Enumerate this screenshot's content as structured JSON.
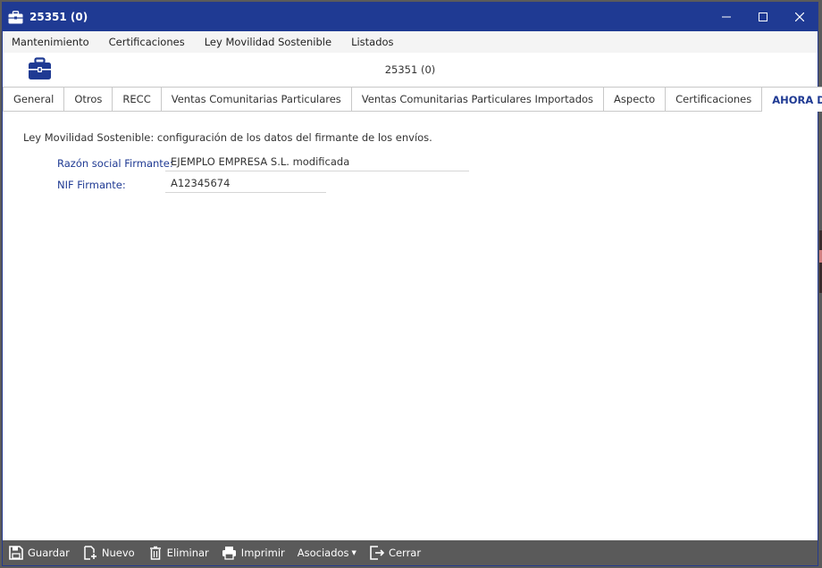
{
  "window": {
    "title": "25351 (0)",
    "minimize": "—",
    "maximize": "☐",
    "close": "✕"
  },
  "menu": [
    "Mantenimiento",
    "Certificaciones",
    "Ley Movilidad Sostenible",
    "Listados"
  ],
  "header": {
    "record_title": "25351 (0)"
  },
  "tabs": [
    {
      "label": "General",
      "active": false
    },
    {
      "label": "Otros",
      "active": false
    },
    {
      "label": "RECC",
      "active": false
    },
    {
      "label": "Ventas Comunitarias Particulares",
      "active": false
    },
    {
      "label": "Ventas Comunitarias Particulares Importados",
      "active": false
    },
    {
      "label": "Aspecto",
      "active": false
    },
    {
      "label": "Certificaciones",
      "active": false
    },
    {
      "label": "AHORA DeCA",
      "active": true
    }
  ],
  "content": {
    "description": "Ley Movilidad Sostenible: configuración de los datos del firmante de los envíos.",
    "fields": [
      {
        "label": "Razón social Firmante:",
        "value": "EJEMPLO EMPRESA S.L. modificada"
      },
      {
        "label": "NIF Firmante:",
        "value": "A12345674"
      }
    ]
  },
  "toolbar": {
    "save": "Guardar",
    "new": "Nuevo",
    "delete": "Eliminar",
    "print": "Imprimir",
    "associated": "Asociados",
    "close": "Cerrar"
  },
  "colors": {
    "title_bar": "#1f3a93",
    "accent": "#1f3a93",
    "toolbar": "#5a5a5a"
  }
}
